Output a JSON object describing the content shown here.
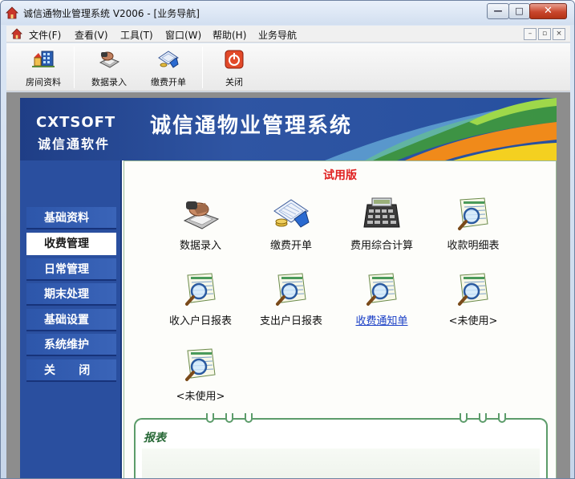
{
  "window": {
    "title": "诚信通物业管理系统 V2006 - [业务导航]"
  },
  "menubar": {
    "items": [
      "文件(F)",
      "查看(V)",
      "工具(T)",
      "窗口(W)",
      "帮助(H)",
      "业务导航"
    ],
    "mdi_controls": [
      "–",
      "▫",
      "×"
    ]
  },
  "toolbar": {
    "tools": [
      {
        "label": "房间资料",
        "icon": "room-data-icon"
      },
      {
        "label": "数据录入",
        "icon": "keyboard-icon"
      },
      {
        "label": "缴费开单",
        "icon": "billing-icon"
      },
      {
        "label": "关闭",
        "icon": "power-icon"
      }
    ]
  },
  "banner": {
    "brand_en": "CXTSOFT",
    "brand_cn": "诚信通软件",
    "title": "诚信通物业管理系统"
  },
  "nav": {
    "items": [
      {
        "label": "基础资料",
        "active": false
      },
      {
        "label": "收费管理",
        "active": true
      },
      {
        "label": "日常管理",
        "active": false
      },
      {
        "label": "期末处理",
        "active": false
      },
      {
        "label": "基础设置",
        "active": false
      },
      {
        "label": "系统维护",
        "active": false
      },
      {
        "label": "关      闭",
        "active": false
      }
    ]
  },
  "content": {
    "trial_label": "试用版",
    "functions": [
      {
        "label": "数据录入",
        "icon": "keyboard-icon",
        "link": false
      },
      {
        "label": "缴费开单",
        "icon": "billing-icon",
        "link": false
      },
      {
        "label": "费用综合计算",
        "icon": "calculator-icon",
        "link": false
      },
      {
        "label": "收款明细表",
        "icon": "report-magnifier-icon",
        "link": false
      },
      {
        "label": "收入户日报表",
        "icon": "report-magnifier-icon",
        "link": false
      },
      {
        "label": "支出户日报表",
        "icon": "report-magnifier-icon",
        "link": false
      },
      {
        "label": "收费通知单",
        "icon": "report-magnifier-icon",
        "link": true
      },
      {
        "label": "<未使用>",
        "icon": "report-magnifier-icon",
        "link": false
      },
      {
        "label": "<未使用>",
        "icon": "report-magnifier-icon",
        "link": false
      }
    ],
    "report_label": "报表"
  },
  "colors": {
    "nav_bg": "#2a4f9f",
    "trial_red": "#e02020",
    "link_blue": "#1a3fc6",
    "report_green": "#276836"
  }
}
